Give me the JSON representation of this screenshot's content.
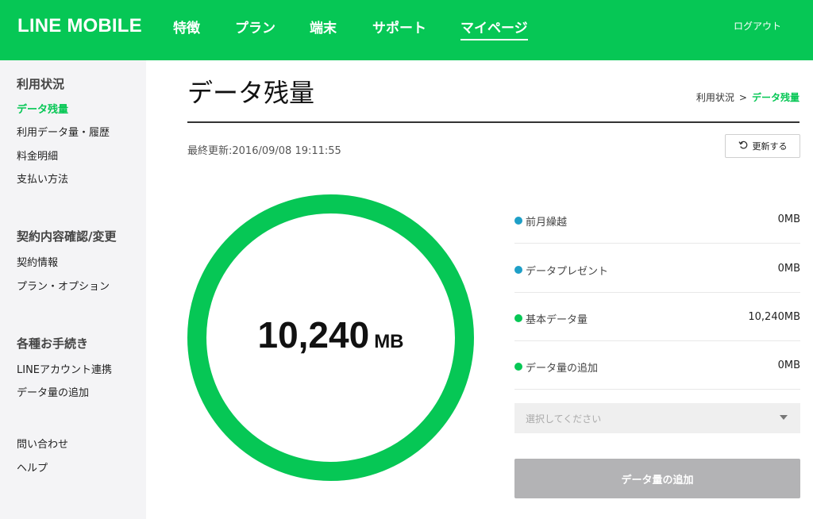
{
  "header": {
    "logo": "LINE MOBILE",
    "nav": [
      "特徴",
      "プラン",
      "端末",
      "サポート",
      "マイページ"
    ],
    "active_nav": "マイページ",
    "logout": "ログアウト",
    "brand_color": "#06c755"
  },
  "sidebar": {
    "sections": [
      {
        "heading": "利用状況",
        "items": [
          "データ残量",
          "利用データ量・履歴",
          "料金明細",
          "支払い方法"
        ]
      },
      {
        "heading": "契約内容確認/変更",
        "items": [
          "契約情報",
          "プラン・オプション"
        ]
      },
      {
        "heading": "各種お手続き",
        "items": [
          "LINEアカウント連携",
          "データ量の追加"
        ]
      },
      {
        "heading": "",
        "items": [
          "問い合わせ",
          "ヘルプ"
        ]
      }
    ],
    "active_item": "データ残量"
  },
  "main": {
    "title": "データ残量",
    "breadcrumb": {
      "parent": "利用状況",
      "separator": ">",
      "current": "データ残量"
    },
    "last_updated": "最終更新:2016/09/08 19:11:55",
    "refresh_label": "更新する",
    "gauge": {
      "value": "10,240",
      "unit": "MB",
      "fill_fraction": 1.0,
      "color": "#06c755"
    },
    "breakdown": [
      {
        "label": "前月繰越",
        "value": "0MB",
        "dot_color": "#1e9fc7"
      },
      {
        "label": "データプレゼント",
        "value": "0MB",
        "dot_color": "#1e9fc7"
      },
      {
        "label": "基本データ量",
        "value": "10,240MB",
        "dot_color": "#06c755"
      },
      {
        "label": "データ量の追加",
        "value": "0MB",
        "dot_color": "#06c755"
      }
    ],
    "select_placeholder": "選択してください",
    "add_button": "データ量の追加"
  }
}
